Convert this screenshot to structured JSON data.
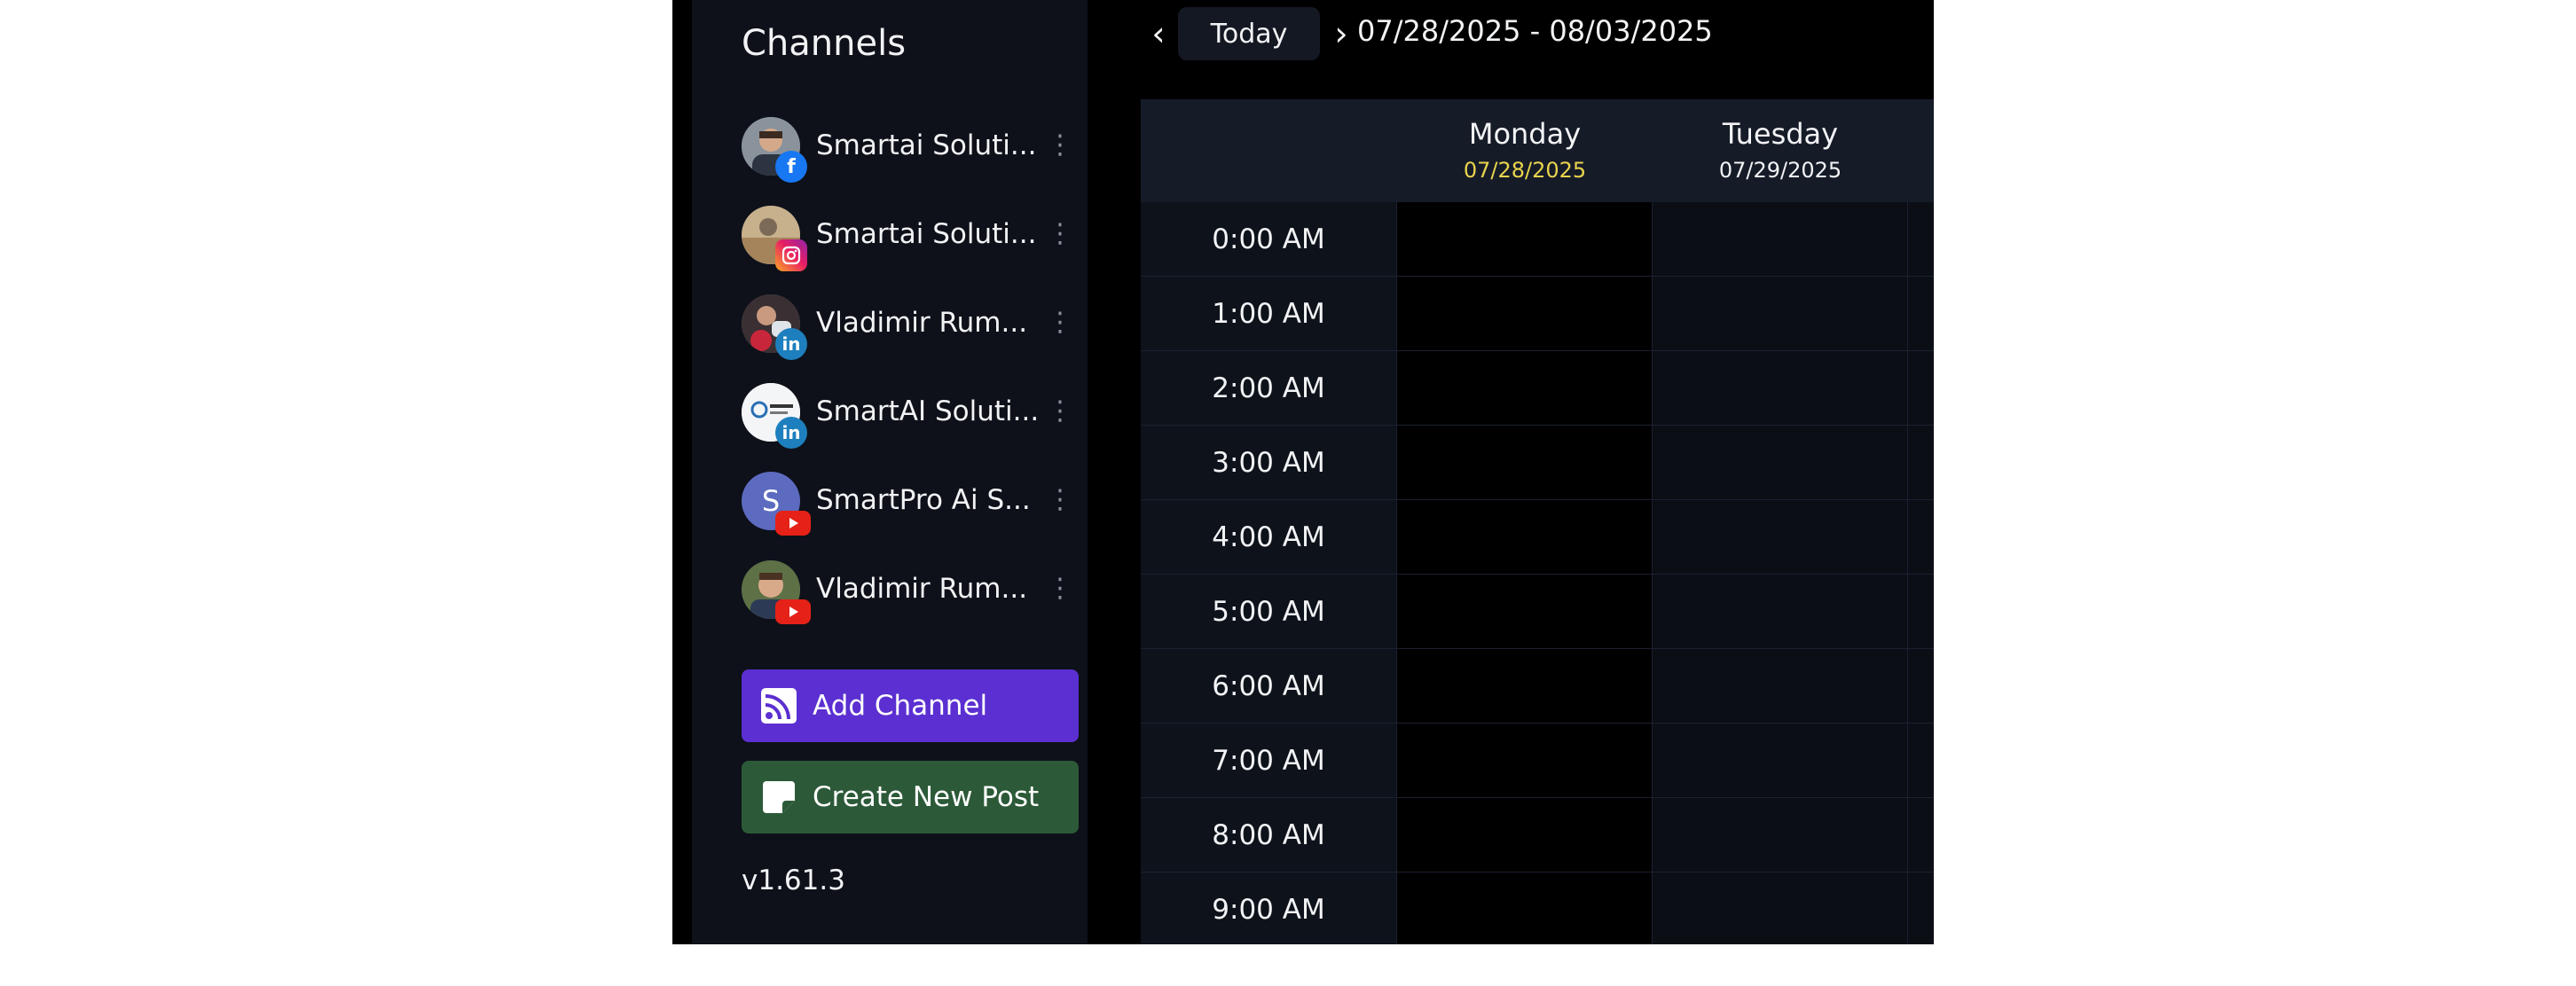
{
  "sidebar": {
    "title": "Channels",
    "channels": [
      {
        "name": "Smartai Soluti...",
        "network": "facebook",
        "network_icon": "facebook-icon"
      },
      {
        "name": "Smartai Soluti...",
        "network": "instagram",
        "network_icon": "instagram-icon"
      },
      {
        "name": "Vladimir Rum...",
        "network": "linkedin",
        "network_icon": "linkedin-icon"
      },
      {
        "name": "SmartAI Soluti...",
        "network": "linkedin",
        "network_icon": "linkedin-icon"
      },
      {
        "name": "SmartPro Ai S...",
        "network": "youtube",
        "network_icon": "youtube-icon",
        "avatar_letter": "S"
      },
      {
        "name": "Vladimir Rum...",
        "network": "youtube",
        "network_icon": "youtube-icon"
      }
    ],
    "add_channel_label": "Add Channel",
    "create_post_label": "Create New Post",
    "version": "v1.61.3"
  },
  "nav": {
    "today_label": "Today",
    "date_range": "07/28/2025 - 08/03/2025"
  },
  "calendar": {
    "days": [
      {
        "name": "Monday",
        "date": "07/28/2025",
        "is_today": true
      },
      {
        "name": "Tuesday",
        "date": "07/29/2025",
        "is_today": false
      }
    ],
    "times": [
      "0:00 AM",
      "1:00 AM",
      "2:00 AM",
      "3:00 AM",
      "4:00 AM",
      "5:00 AM",
      "6:00 AM",
      "7:00 AM",
      "8:00 AM",
      "9:00 AM"
    ]
  },
  "colors": {
    "accent_purple": "#5b2fd1",
    "accent_green": "#2c5a38",
    "today_date": "#e8d44d",
    "facebook": "#1877f2",
    "linkedin": "#1d7fbd",
    "youtube": "#e62117"
  }
}
